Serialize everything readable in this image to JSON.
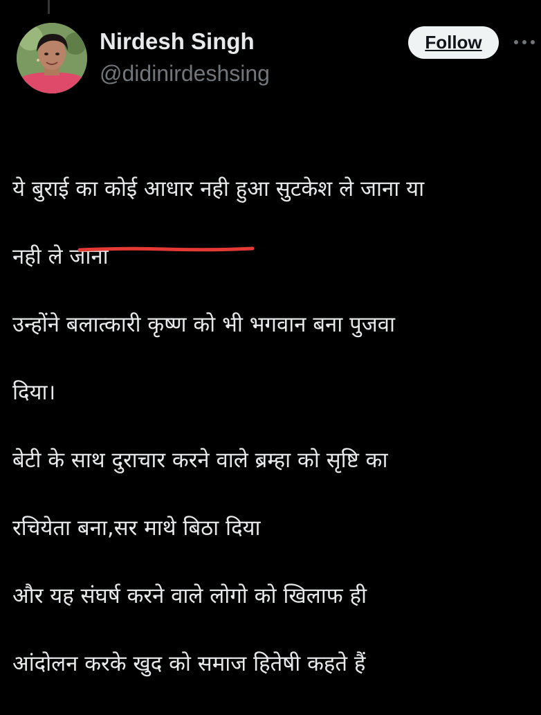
{
  "profile": {
    "display_name": "Nirdesh Singh",
    "handle": "@didinirdeshsing",
    "avatar_icon": "user-avatar"
  },
  "actions": {
    "follow_label": "Follow",
    "more_icon": "more-horizontal-icon"
  },
  "tweet": {
    "lines": [
      "ये बुराई का कोई आधार नही हुआ सुटकेश ले जाना या",
      "नही ले जाना",
      "उन्होंने बलात्कारी कृष्ण को भी भगवान बना पुजवा",
      "दिया।",
      "बेटी के साथ दुराचार करने वाले ब्रम्हा को सृष्टि का",
      "रचियेता बना,सर माथे बिठा  दिया",
      "और यह संघर्ष करने वाले लोगो को खिलाफ ही",
      "आंदोलन करके खुद को समाज हितेषी कहते हैं"
    ],
    "annotation_color": "#e53935"
  },
  "colors": {
    "background": "#000000",
    "primary_text": "#e7e9ea",
    "secondary_text": "#71767b",
    "button_bg": "#eff3f4"
  }
}
